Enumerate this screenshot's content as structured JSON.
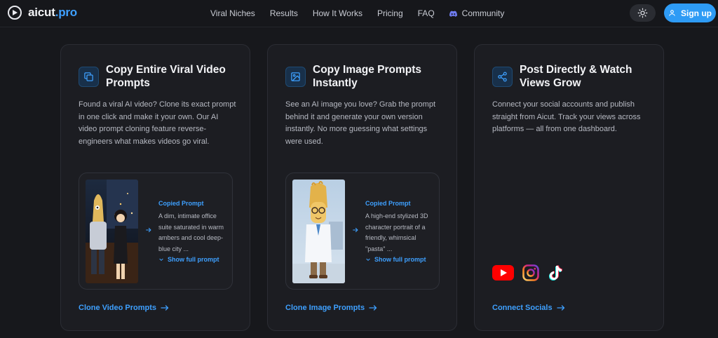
{
  "nav": {
    "logo": {
      "name": "aicut",
      "tld": ".pro"
    },
    "links": [
      "Viral Niches",
      "Results",
      "How It Works",
      "Pricing",
      "FAQ"
    ],
    "community": "Community",
    "signup": "Sign up"
  },
  "cards": [
    {
      "icon": "copy-icon",
      "title": "Copy Entire Viral Video Prompts",
      "desc": "Found a viral AI video? Clone its exact prompt in one click and make it your own. Our AI video prompt cloning feature reverse-engineers what makes videos go viral.",
      "preview": {
        "label": "Copied Prompt",
        "text": "A dim, intimate office suite saturated in warm ambers and cool deep-blue city ...",
        "show": "Show full prompt"
      },
      "link": "Clone Video Prompts"
    },
    {
      "icon": "image-icon",
      "title": "Copy Image Prompts Instantly",
      "desc": "See an AI image you love? Grab the prompt behind it and generate your own version instantly. No more guessing what settings were used.",
      "preview": {
        "label": "Copied Prompt",
        "text": "A high-end stylized 3D character portrait of a friendly, whimsical \"pasta\" ...",
        "show": "Show full prompt"
      },
      "link": "Clone Image Prompts"
    },
    {
      "icon": "share-icon",
      "title": "Post Directly & Watch Views Grow",
      "desc": "Connect your social accounts and publish straight from Aicut. Track your views across platforms — all from one dashboard.",
      "socials": [
        "youtube-icon",
        "instagram-icon",
        "tiktok-icon"
      ],
      "link": "Connect Socials"
    }
  ],
  "colors": {
    "accent": "#2e9bf5",
    "link": "#3ea0ff",
    "background": "#17181c",
    "card": "#1c1d22"
  }
}
